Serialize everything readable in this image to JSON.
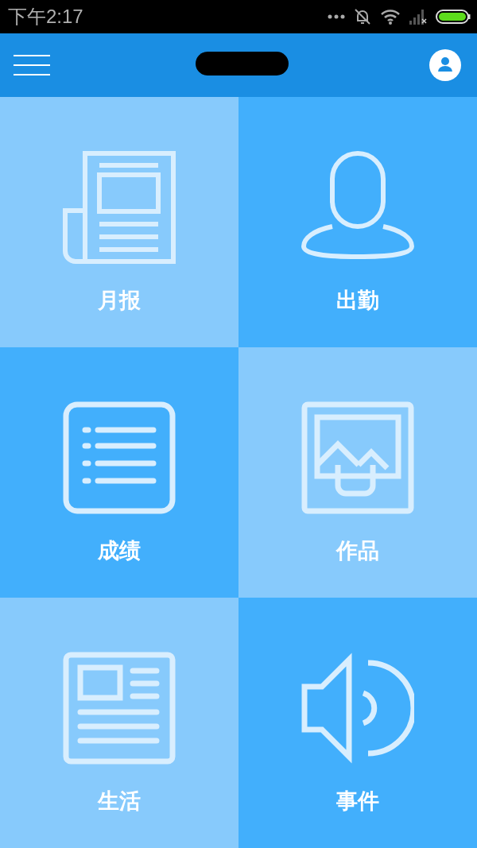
{
  "status_bar": {
    "time": "下午2:17"
  },
  "header": {
    "title_redacted": true
  },
  "tiles": [
    {
      "label": "月报",
      "kind": "newspaper",
      "color": "#87cafc"
    },
    {
      "label": "出勤",
      "kind": "person",
      "color": "#42affc"
    },
    {
      "label": "成绩",
      "kind": "list",
      "color": "#42affc"
    },
    {
      "label": "作品",
      "kind": "image",
      "color": "#87cafc"
    },
    {
      "label": "生活",
      "kind": "article",
      "color": "#87cafc"
    },
    {
      "label": "事件",
      "kind": "speaker",
      "color": "#42affc"
    }
  ]
}
